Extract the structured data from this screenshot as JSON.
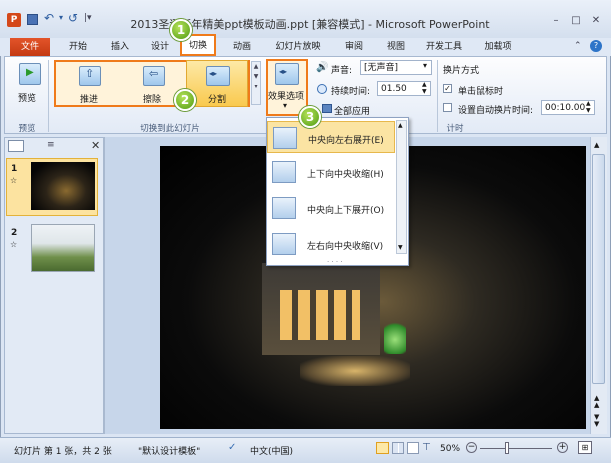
{
  "window": {
    "title": "2013圣诞新年精美ppt模板动画.ppt [兼容模式] - Microsoft PowerPoint",
    "min": "–",
    "restore": "□",
    "close": "✕"
  },
  "ribbon_tabs": {
    "file": "文件",
    "items": [
      "开始",
      "插入",
      "设计",
      "切换",
      "动画",
      "幻灯片放映",
      "审阅",
      "视图",
      "开发工具",
      "加载项"
    ],
    "active": "切换"
  },
  "preview": {
    "button": "预览",
    "group": "预览"
  },
  "transitions": {
    "items": [
      "推进",
      "擦除",
      "分割"
    ],
    "group": "切换到此幻灯片"
  },
  "effect_options": {
    "label": "效果选项",
    "arrow": "▾"
  },
  "timing": {
    "sound_label": "声音:",
    "sound_value": "[无声音]",
    "duration_label": "持续时间:",
    "duration_value": "01.50",
    "apply_all": "全部应用",
    "advance_label": "换片方式",
    "on_click": "单击鼠标时",
    "on_click_checked": true,
    "auto_label": "设置自动换片时间:",
    "auto_value": "00:10.00",
    "auto_checked": false,
    "group": "计时"
  },
  "effect_menu": [
    {
      "label": "中央向左右展开(E)"
    },
    {
      "label": "上下向中央收缩(H)"
    },
    {
      "label": "中央向上下展开(O)"
    },
    {
      "label": "左右向中央收缩(V)"
    }
  ],
  "callouts": [
    "1",
    "2",
    "3"
  ],
  "slides": [
    {
      "num": "1",
      "star": "☆"
    },
    {
      "num": "2",
      "star": "☆"
    }
  ],
  "status": {
    "slide": "幻灯片 第 1 张，共 2 张",
    "theme": "\"默认设计模板\"",
    "lang": "中文(中国)",
    "zoom": "50%"
  },
  "colors": {
    "accent": "#ef7a1a",
    "file_tab": "#d5451a",
    "callout": "#5aa31a"
  }
}
